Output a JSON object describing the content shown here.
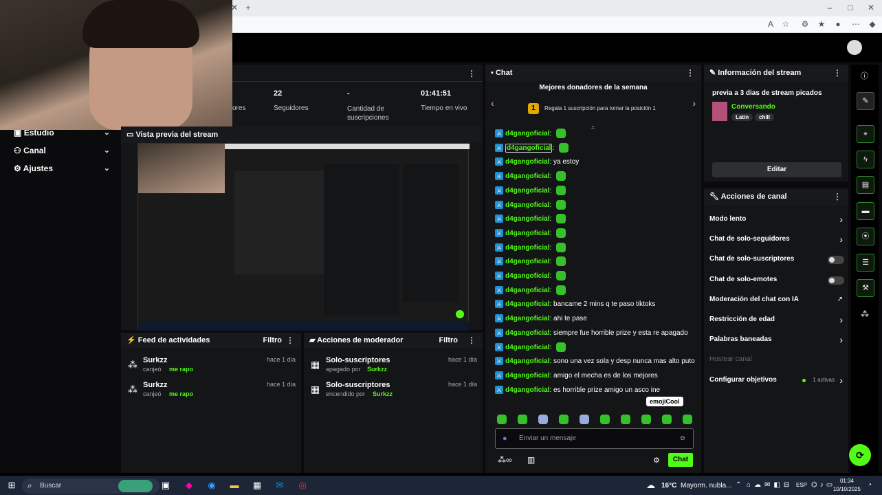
{
  "browser": {
    "new_tab_icon": "plus-icon",
    "close_tab_icon": "close-icon"
  },
  "stats": [
    {
      "value": "",
      "label": "ores"
    },
    {
      "value": "22",
      "label": "Seguidores"
    },
    {
      "value": "-",
      "label": "Cantidad de suscripciones"
    },
    {
      "value": "01:41:51",
      "label": "Tiempo en vivo"
    }
  ],
  "sidebar": {
    "items": [
      {
        "label": "Estudio"
      },
      {
        "label": "Canal"
      },
      {
        "label": "Ajustes"
      }
    ]
  },
  "preview": {
    "title": "Vista previa del stream"
  },
  "activity_feed": {
    "title": "Feed de actividades",
    "filter_label": "Filtro",
    "items": [
      {
        "user": "Surkzz",
        "time": "hace 1 día",
        "action": "canjeó",
        "reward": "me rapo"
      },
      {
        "user": "Surkzz",
        "time": "hace 1 día",
        "action": "canjeó",
        "reward": "me rapo"
      }
    ]
  },
  "mod_actions": {
    "title": "Acciones de moderador",
    "filter_label": "Filtro",
    "items": [
      {
        "title": "Solo-suscriptores",
        "time": "hace 1 día",
        "desc": "apagado por",
        "user": "Surkzz"
      },
      {
        "title": "Solo-suscriptores",
        "time": "hace 1 día",
        "desc": "encendido por",
        "user": "Surkzz"
      }
    ]
  },
  "chat": {
    "title": "Chat",
    "donors_title": "Mejores donadores de la semana",
    "donor_rank": "1",
    "donor_prompt": "Regala 1 suscripción para tomar la posición 1",
    "username": "d4gangoficial",
    "messages": [
      {
        "text": "",
        "emote": true
      },
      {
        "text": "",
        "emote": true
      },
      {
        "text": "ya estoy",
        "emote": false
      },
      {
        "text": "",
        "emote": true
      },
      {
        "text": "",
        "emote": true
      },
      {
        "text": "",
        "emote": true
      },
      {
        "text": "",
        "emote": true
      },
      {
        "text": "",
        "emote": true
      },
      {
        "text": "",
        "emote": true
      },
      {
        "text": "",
        "emote": true
      },
      {
        "text": "",
        "emote": true
      },
      {
        "text": "",
        "emote": true
      },
      {
        "text": "bancame 2 mins q te paso tiktoks",
        "emote": false
      },
      {
        "text": "ahi te pase",
        "emote": false
      },
      {
        "text": "siempre fue horrible prize y esta re apagado",
        "emote": false
      },
      {
        "text": "",
        "emote": true
      },
      {
        "text": "sono una vez sola y desp nunca mas alto puto",
        "emote": false
      },
      {
        "text": "amigo el mecha es de los mejores",
        "emote": false
      },
      {
        "text": "es horrible prize amigo un asco ine",
        "emote": false
      }
    ],
    "tooltip": "emojiCool",
    "input_placeholder": "Enviar un mensaje",
    "send_label": "Chat"
  },
  "stream_info": {
    "title": "Información del stream",
    "stream_title": "previa a 3 dias de stream picados",
    "category": "Conversando",
    "tags": [
      "Latin",
      "chill"
    ],
    "edit_label": "Editar"
  },
  "channel_actions": {
    "title": "Acciones de canal",
    "items": [
      {
        "label": "Modo lento",
        "control": "chevron"
      },
      {
        "label": "Chat de solo-seguidores",
        "control": "chevron"
      },
      {
        "label": "Chat de solo-suscriptores",
        "control": "toggle"
      },
      {
        "label": "Chat de solo-emotes",
        "control": "toggle"
      },
      {
        "label": "Moderación del chat con IA",
        "control": "external"
      },
      {
        "label": "Restricción de edad",
        "control": "chevron"
      },
      {
        "label": "Palabras baneadas",
        "control": "chevron"
      },
      {
        "label": "Hostear canal",
        "control": "none"
      },
      {
        "label": "Configurar objetivos",
        "control": "chevron",
        "status": "1 activas"
      }
    ]
  },
  "taskbar": {
    "search_placeholder": "Buscar",
    "weather": "16°C",
    "weather_desc": "Mayorm. nubla...",
    "lang": "ESP",
    "time": "01:34",
    "date": "10/10/2025"
  },
  "colors": {
    "accent": "#53fc18",
    "panel": "#141517",
    "background": "#0b0b0d"
  }
}
